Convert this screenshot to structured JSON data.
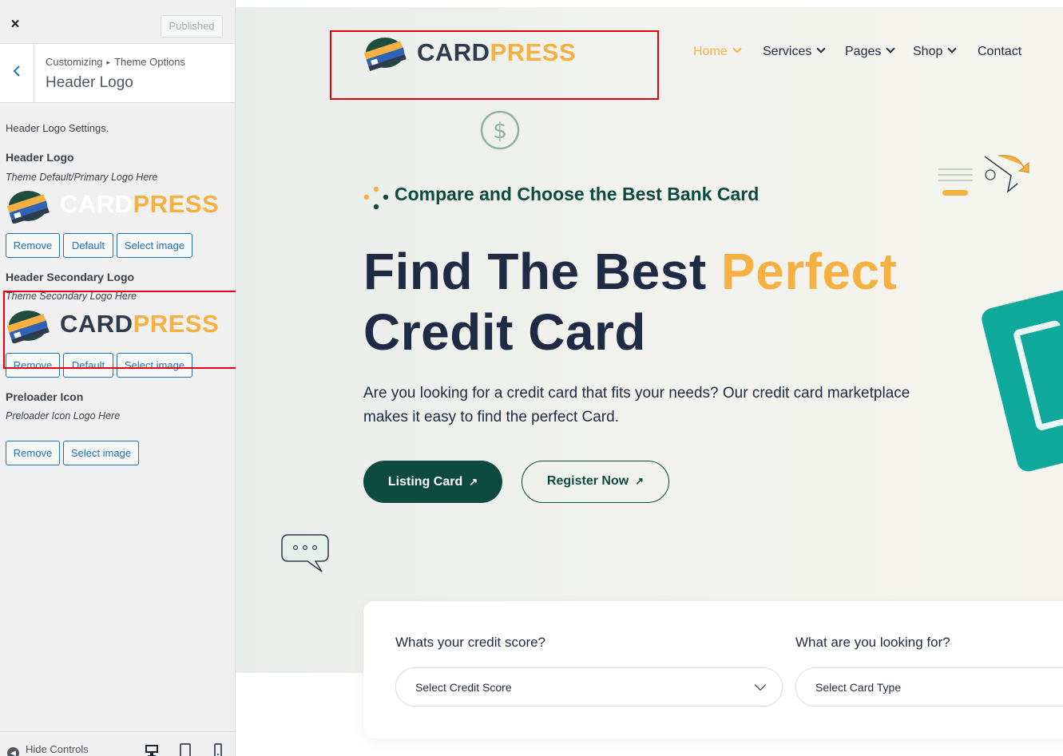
{
  "customizer": {
    "close_label": "×",
    "published_label": "Published",
    "breadcrumb": [
      "Customizing",
      "Theme Options"
    ],
    "section_title": "Header Logo",
    "settings_intro": "Header Logo Settings.",
    "header_logo": {
      "label": "Header Logo",
      "description": "Theme Default/Primary Logo Here",
      "buttons": [
        "Remove",
        "Default",
        "Select image"
      ]
    },
    "header_secondary_logo": {
      "label": "Header Secondary Logo",
      "description": "Theme Secondary Logo Here",
      "buttons": [
        "Remove",
        "Default",
        "Select image"
      ]
    },
    "preloader_icon": {
      "label": "Preloader Icon",
      "description": "Preloader Icon Logo Here",
      "buttons": [
        "Remove",
        "Select image"
      ]
    },
    "hide_controls_label": "Hide Controls",
    "devices": [
      "desktop-icon",
      "tablet-icon",
      "mobile-icon"
    ]
  },
  "logo": {
    "word_part1": "CARD",
    "word_part2": "PRESS",
    "color_dark": "#2f3a4d",
    "color_light": "#ffffff",
    "color_accent": "#f5b042"
  },
  "preview": {
    "nav": [
      {
        "label": "Home",
        "active": true,
        "dropdown": true
      },
      {
        "label": "Services",
        "active": false,
        "dropdown": true
      },
      {
        "label": "Pages",
        "active": false,
        "dropdown": true
      },
      {
        "label": "Shop",
        "active": false,
        "dropdown": true
      },
      {
        "label": "Contact",
        "active": false,
        "dropdown": false
      }
    ],
    "tagline": "Compare and Choose the Best Bank Card",
    "headline_part1": "Find The Best ",
    "headline_accent": "Perfect",
    "headline_part2": "Credit Card",
    "paragraph": "Are you looking for a credit card that fits your needs? Our credit card marketplace makes it easy to find the perfect Card.",
    "btn_primary": "Listing Card",
    "btn_secondary": "Register Now",
    "arrow": "↗",
    "search": {
      "q1_label": "Whats your credit score?",
      "q1_value": "Select Credit Score",
      "q2_label": "What are you looking for?",
      "q2_value": "Select Card Type"
    }
  },
  "colors": {
    "accent": "#f5b042",
    "brand_green": "#0d4a3f",
    "text_dark": "#1f2a44",
    "wp_blue": "#2271b1",
    "highlight": "#e3000f"
  }
}
